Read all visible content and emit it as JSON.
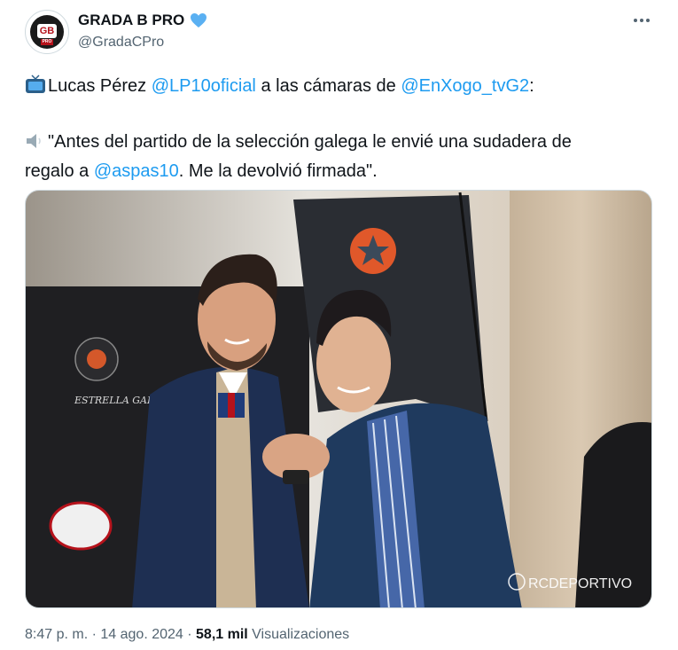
{
  "author": {
    "display_name": "GRADA B PRO",
    "handle": "@GradaCPro",
    "avatar_initials": "GB",
    "avatar_sub": "PRO",
    "verified_icon": "blue-heart-icon"
  },
  "tweet": {
    "line1": {
      "icon": "tv-icon",
      "text_a": "Lucas Pérez ",
      "mention_a": "@LP10oficial",
      "text_b": " a las cámaras de ",
      "mention_b": "@EnXogo_tvG2",
      "text_c": ":"
    },
    "line2": {
      "icon": "speaker-icon",
      "text": "\"Antes del partido de la selección galega le envié una sudadera de"
    },
    "line3": {
      "text_a": "regalo a ",
      "mention": "@aspas10",
      "text_b": ". Me la devolvió firmada\"."
    }
  },
  "media": {
    "watermark": "RCDEPORTIVO",
    "banner_text": "ESTRELLA GALICIA"
  },
  "footer": {
    "time": "8:47 p. m.",
    "separator": " · ",
    "date": "14 ago. 2024",
    "views_count": "58,1 mil",
    "views_label": " Visualizaciones"
  },
  "colors": {
    "accent": "#1d9bf0",
    "secondary_text": "#536471",
    "primary_text": "#0f1419"
  }
}
